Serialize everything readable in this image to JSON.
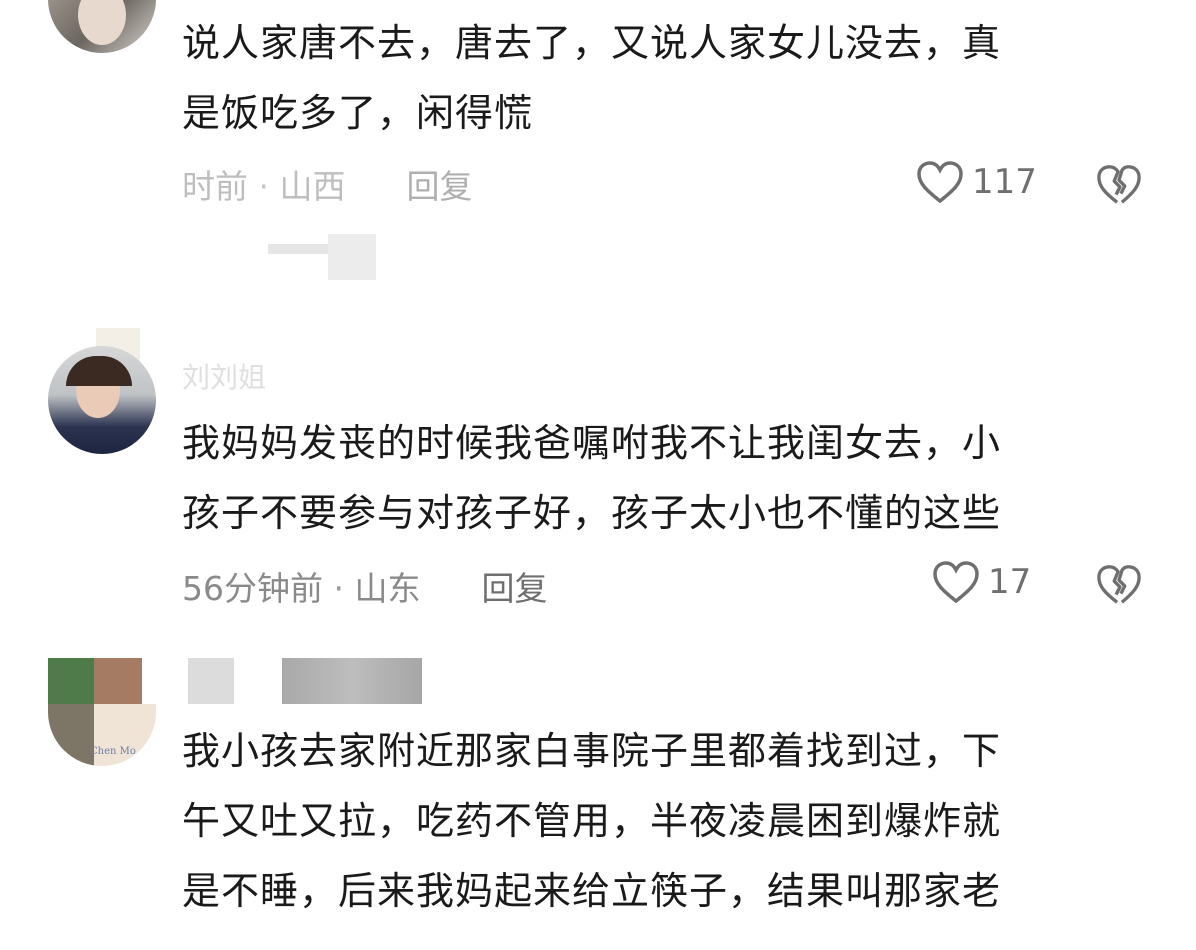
{
  "comments": [
    {
      "username": "",
      "lines": [
        "说人家唐不去，唐去了，又说人家女儿没去，真",
        "是饭吃多了，闲得慌"
      ],
      "time": "时前",
      "location": "山西",
      "reply": "回复",
      "likes": "117"
    },
    {
      "username": "刘刘姐",
      "lines": [
        "我妈妈发丧的时候我爸嘱咐我不让我闺女去，小",
        "孩子不要参与对孩子好，孩子太小也不懂的这些"
      ],
      "time": "56分钟前",
      "location": "山东",
      "reply": "回复",
      "likes": "17"
    },
    {
      "username": "",
      "lines": [
        "我小孩去家附近那家白事院子里都着找到过，下",
        "午又吐又拉，吃药不管用，半夜凌晨困到爆炸就",
        "是不睡，后来我妈起来给立筷子，结果叫那家老"
      ],
      "avatar_text": "Chen Mo"
    }
  ],
  "icons": [
    "heart-icon",
    "broken-heart-icon"
  ],
  "colors": {
    "text": "#1a1a1a",
    "meta": "#8a8a8a",
    "icon": "#6f6f6f"
  }
}
